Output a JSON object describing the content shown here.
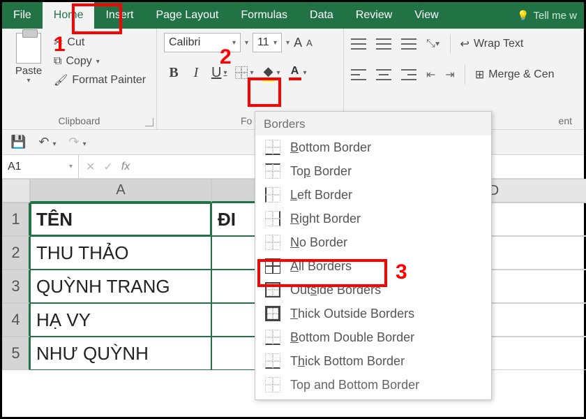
{
  "tabs": {
    "file": "File",
    "home": "Home",
    "insert": "Insert",
    "pageLayout": "Page Layout",
    "formulas": "Formulas",
    "data": "Data",
    "review": "Review",
    "view": "View",
    "tellme": "Tell me w"
  },
  "clipboard": {
    "paste": "Paste",
    "cut": "Cut",
    "copy": "Copy",
    "formatPainter": "Format Painter",
    "groupLabel": "Clipboard"
  },
  "font": {
    "name": "Calibri",
    "size": "11",
    "bold": "B",
    "italic": "I",
    "underline": "U",
    "fontColorGlyph": "A",
    "groupLabel": "Fo"
  },
  "alignment": {
    "wrapText": "Wrap Text",
    "merge": "Merge & Cen",
    "groupLabelEnd": "ent"
  },
  "qat": {
    "nameBox": "A1"
  },
  "borders": {
    "title": "Borders",
    "items": [
      "Bottom Border",
      "Top Border",
      "Left Border",
      "Right Border",
      "No Border",
      "All Borders",
      "Outside Borders",
      "Thick Outside Borders",
      "Bottom Double Border",
      "Thick Bottom Border",
      "Top and Bottom Border"
    ]
  },
  "columns": {
    "A": "A",
    "D": "D"
  },
  "rows": [
    "1",
    "2",
    "3",
    "4",
    "5"
  ],
  "cells": {
    "A1": "TÊN",
    "B1": "ĐI",
    "A2": "THU THẢO",
    "A3": "QUỲNH TRANG",
    "A4": "HẠ VY",
    "A5": "NHƯ QUỲNH"
  },
  "annotations": {
    "n1": "1",
    "n2": "2",
    "n3": "3"
  }
}
